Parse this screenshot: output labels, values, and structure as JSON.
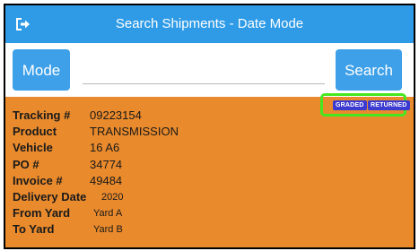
{
  "header": {
    "title": "Search Shipments - Date Mode",
    "back_icon": "logout-arrow-icon"
  },
  "search": {
    "mode_label": "Mode",
    "search_label": "Search",
    "input_value": "",
    "placeholder": ""
  },
  "badges": {
    "graded": "GRADED",
    "returned": "RETURNED"
  },
  "shipment": {
    "fields": [
      {
        "label": "Tracking #",
        "value": "09223154"
      },
      {
        "label": "Product",
        "value": "TRANSMISSION"
      },
      {
        "label": "Vehicle",
        "value": "16 A6"
      },
      {
        "label": "PO #",
        "value": "34774"
      },
      {
        "label": "Invoice #",
        "value": "49484"
      },
      {
        "label": "Delivery Date",
        "value": "2020"
      },
      {
        "label": "From Yard",
        "value": "Yard A"
      },
      {
        "label": "To Yard",
        "value": "Yard B"
      }
    ]
  },
  "colors": {
    "app_bar": "#2f9be6",
    "button": "#3da0e8",
    "card": "#e98a2c",
    "badge": "#3b3ad1",
    "highlight": "#45e81e"
  }
}
